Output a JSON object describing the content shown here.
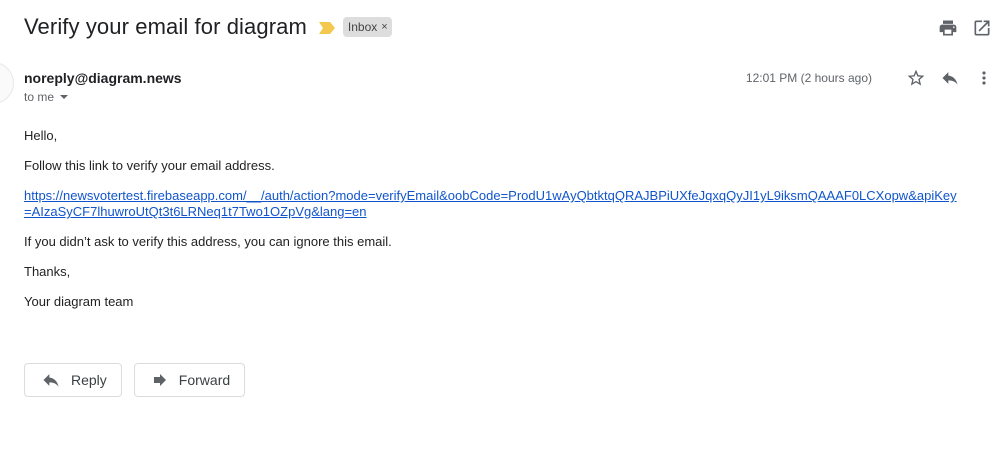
{
  "email": {
    "subject": "Verify your email for diagram",
    "label": "Inbox",
    "label_remove": "×",
    "sender": "noreply@diagram.news",
    "recipient": "to me",
    "timestamp": "12:01 PM (2 hours ago)",
    "body": {
      "greeting": "Hello,",
      "intro": "Follow this link to verify your email address.",
      "link": "https://newsvotertest.firebaseapp.com/__/auth/action?mode=verifyEmail&oobCode=ProdU1wAyQbtktqQRAJBPiUXfeJqxqQyJI1yL9iksmQAAAF0LCXopw&apiKey=AIzaSyCF7lhuwroUtQt3t6LRNeq1t7Two1OZpVg&lang=en",
      "ignore_note": "If you didn’t ask to verify this address, you can ignore this email.",
      "thanks": "Thanks,",
      "signature": "Your diagram team"
    }
  },
  "actions": {
    "reply_label": "Reply",
    "forward_label": "Forward"
  },
  "colors": {
    "link": "#1155cc",
    "importance_marker": "#f4c84f",
    "label_chip": "#dddddd",
    "icon": "#5f6368"
  },
  "icons": [
    "importance-marker-icon",
    "print-icon",
    "open-new-window-icon",
    "star-icon",
    "reply-icon",
    "more-vert-icon",
    "forward-icon"
  ]
}
